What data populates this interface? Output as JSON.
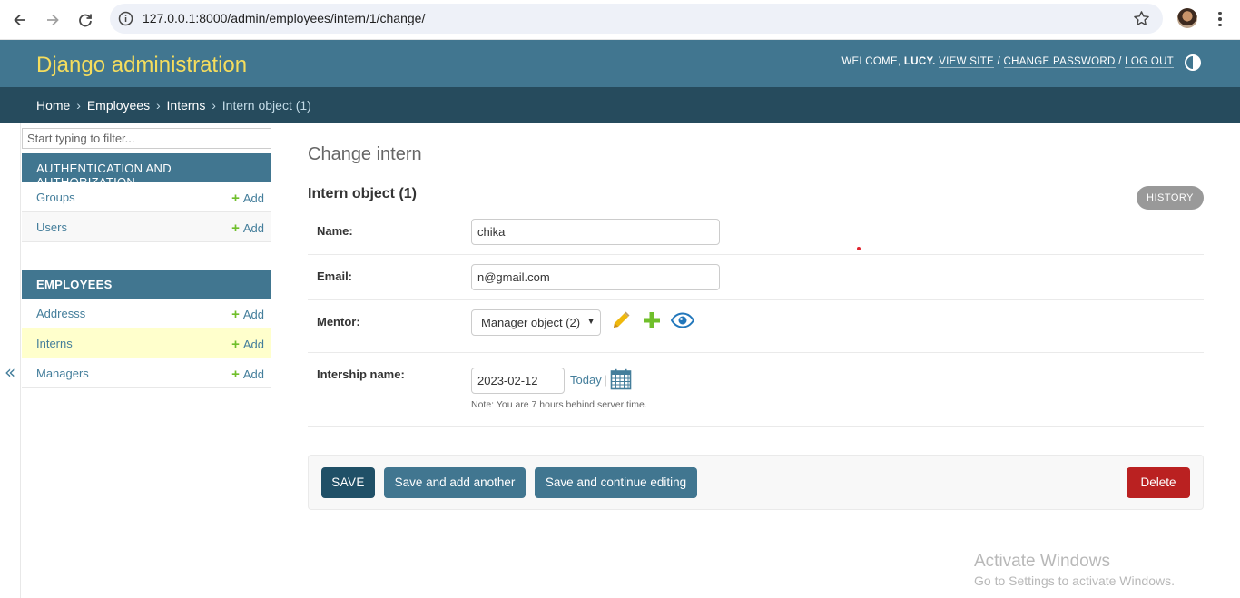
{
  "browser": {
    "url": "127.0.0.1:8000/admin/employees/intern/1/change/"
  },
  "header": {
    "branding": "Django administration",
    "welcome": "WELCOME,",
    "username": "LUCY.",
    "view_site": "VIEW SITE",
    "change_password": "CHANGE PASSWORD",
    "log_out": "LOG OUT",
    "separator": "/"
  },
  "breadcrumbs": {
    "home": "Home",
    "app": "Employees",
    "model": "Interns",
    "current": "Intern object (1)",
    "sep": "›"
  },
  "sidebar": {
    "filter_placeholder": "Start typing to filter...",
    "toggle": "«",
    "apps": [
      {
        "caption": "AUTHENTICATION AND AUTHORIZATION",
        "models": [
          {
            "name": "Groups",
            "add": "Add"
          },
          {
            "name": "Users",
            "add": "Add"
          }
        ]
      },
      {
        "caption": "EMPLOYEES",
        "models": [
          {
            "name": "Addresss",
            "add": "Add"
          },
          {
            "name": "Interns",
            "add": "Add",
            "active": true
          },
          {
            "name": "Managers",
            "add": "Add"
          }
        ]
      }
    ]
  },
  "main": {
    "title": "Change intern",
    "object_title": "Intern object (1)",
    "history": "HISTORY",
    "fields": {
      "name": {
        "label": "Name:",
        "value": "chika"
      },
      "email": {
        "label": "Email:",
        "value": "n@gmail.com"
      },
      "mentor": {
        "label": "Mentor:",
        "value": "Manager object (2)"
      },
      "internship": {
        "label": "Intership name:",
        "value": "2023-02-12",
        "today": "Today",
        "today_sep": "|",
        "help": "Note: You are 7 hours behind server time."
      }
    },
    "buttons": {
      "save": "SAVE",
      "save_add": "Save and add another",
      "save_continue": "Save and continue editing",
      "delete": "Delete"
    }
  },
  "watermark": {
    "line1": "Activate Windows",
    "line2": "Go to Settings to activate Windows."
  },
  "colors": {
    "header_bg": "#417690",
    "breadcrumb_bg": "#264b5d",
    "branding": "#f5dd5d",
    "delete": "#ba2121",
    "add_plus": "#70bf2b"
  }
}
